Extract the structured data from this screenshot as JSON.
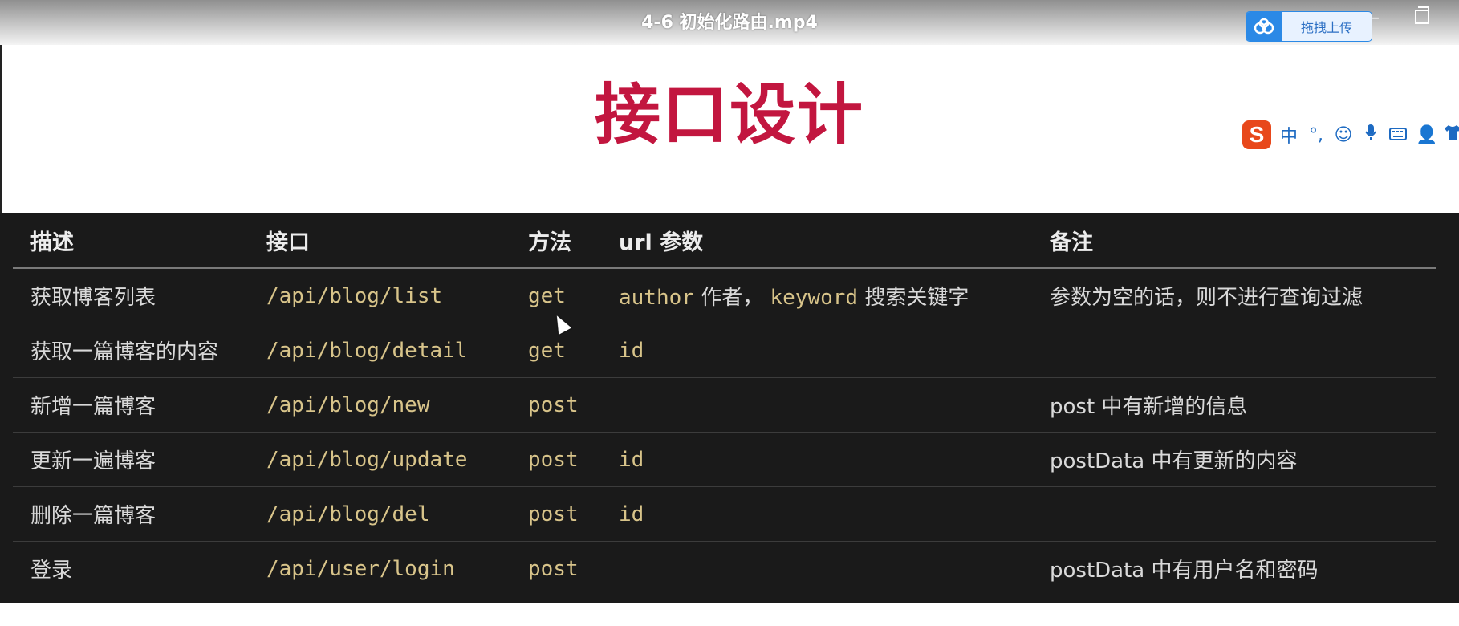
{
  "window": {
    "title": "4-6 初始化路由.mp4",
    "upload_label": "拖拽上传",
    "minimize_label": "–",
    "upload_icon": "cloud-icon",
    "restore_icon": "restore-icon"
  },
  "slide": {
    "heading": "接口设计",
    "heading_color": "#c2163f"
  },
  "ime": {
    "logo": "S",
    "mode": "中",
    "icons": [
      "punctuation-icon",
      "emoji-icon",
      "microphone-icon",
      "keyboard-icon",
      "user-icon",
      "skin-icon"
    ]
  },
  "table": {
    "headers": {
      "desc": "描述",
      "api": "接口",
      "method": "方法",
      "url": "url 参数",
      "note": "备注"
    },
    "rows": [
      {
        "desc": "获取博客列表",
        "api": "/api/blog/list",
        "method": "get",
        "url_code1": "author",
        "url_text1": "作者，",
        "url_code2": "keyword",
        "url_text2": "搜索关键字",
        "note": "参数为空的话，则不进行查询过滤"
      },
      {
        "desc": "获取一篇博客的内容",
        "api": "/api/blog/detail",
        "method": "get",
        "url_code1": "id",
        "url_text1": "",
        "url_code2": "",
        "url_text2": "",
        "note": ""
      },
      {
        "desc": "新增一篇博客",
        "api": "/api/blog/new",
        "method": "post",
        "url_code1": "",
        "url_text1": "",
        "url_code2": "",
        "url_text2": "",
        "note": "post 中有新增的信息"
      },
      {
        "desc": "更新一遍博客",
        "api": "/api/blog/update",
        "method": "post",
        "url_code1": "id",
        "url_text1": "",
        "url_code2": "",
        "url_text2": "",
        "note": "postData 中有更新的内容"
      },
      {
        "desc": "删除一篇博客",
        "api": "/api/blog/del",
        "method": "post",
        "url_code1": "id",
        "url_text1": "",
        "url_code2": "",
        "url_text2": "",
        "note": ""
      },
      {
        "desc": "登录",
        "api": "/api/user/login",
        "method": "post",
        "url_code1": "",
        "url_text1": "",
        "url_code2": "",
        "url_text2": "",
        "note": "postData 中有用户名和密码"
      }
    ]
  },
  "colors": {
    "table_bg": "#1a1a1a",
    "code_color": "#d8c48a",
    "text_color": "#d9d9d9",
    "accent_blue": "#2b89e6"
  }
}
